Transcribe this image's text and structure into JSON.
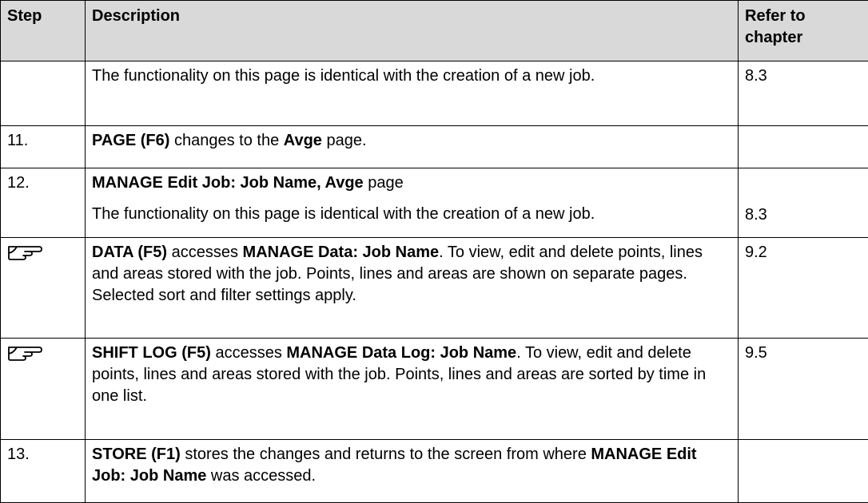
{
  "header": {
    "step": "Step",
    "description": "Description",
    "refer": "Refer to chapter"
  },
  "rows": [
    {
      "step": "",
      "parts": [
        [
          {
            "t": "The functionality on this page is identical with the creation of a new job.",
            "b": false
          }
        ]
      ],
      "refs": [
        "8.3"
      ]
    },
    {
      "step": "11.",
      "parts": [
        [
          {
            "t": "PAGE (F6)",
            "b": true
          },
          {
            "t": " changes to the ",
            "b": false
          },
          {
            "t": "Avge",
            "b": true
          },
          {
            "t": " page.",
            "b": false
          }
        ]
      ],
      "refs": [
        ""
      ]
    },
    {
      "step": "12.",
      "parts": [
        [
          {
            "t": "MANAGE Edit Job: Job Name, Avge",
            "b": true
          },
          {
            "t": " page",
            "b": false
          }
        ],
        [
          {
            "t": "The functionality on this page is identical with the creation of a new job.",
            "b": false
          }
        ]
      ],
      "refs": [
        "",
        "8.3"
      ]
    },
    {
      "step": "",
      "icon": "pointing-hand-note-icon",
      "parts": [
        [
          {
            "t": "DATA (F5)",
            "b": true
          },
          {
            "t": " accesses ",
            "b": false
          },
          {
            "t": "MANAGE Data: Job Name",
            "b": true
          },
          {
            "t": ". To view, edit and delete points, lines and areas stored with the job. Points, lines and areas are shown on separate pages. Selected sort and filter settings apply.",
            "b": false
          }
        ]
      ],
      "refs": [
        "9.2"
      ]
    },
    {
      "step": "",
      "icon": "pointing-hand-note-icon",
      "parts": [
        [
          {
            "t": "SHIFT LOG (F5)",
            "b": true
          },
          {
            "t": " accesses ",
            "b": false
          },
          {
            "t": "MANAGE Data Log: Job Name",
            "b": true
          },
          {
            "t": ". To view, edit and delete points, lines and areas stored with the job. Points, lines and areas are sorted by time in one list.",
            "b": false
          }
        ]
      ],
      "refs": [
        "9.5"
      ]
    },
    {
      "step": "13.",
      "parts": [
        [
          {
            "t": "STORE (F1)",
            "b": true
          },
          {
            "t": " stores the changes and returns to the screen from where ",
            "b": false
          },
          {
            "t": "MANAGE Edit Job: Job Name",
            "b": true
          },
          {
            "t": " was accessed.",
            "b": false
          }
        ]
      ],
      "refs": [
        ""
      ]
    }
  ]
}
